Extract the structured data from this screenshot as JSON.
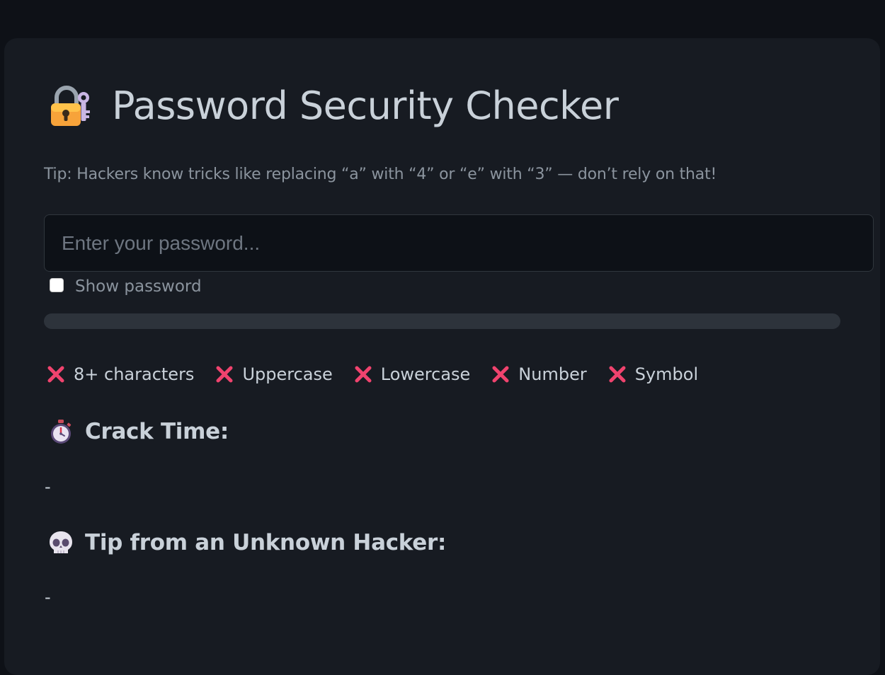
{
  "header": {
    "title": "Password Security Checker",
    "icon": "locked-with-key-icon"
  },
  "tip": "Tip: Hackers know tricks like replacing “a” with “4” or “e” with “3” — don’t rely on that!",
  "password_field": {
    "placeholder": "Enter your password...",
    "value": ""
  },
  "show_password": {
    "label": "Show password",
    "checked": false
  },
  "strength_meter": {
    "level": 0
  },
  "criteria": [
    {
      "label": "8+ characters",
      "met": false,
      "icon": "cross-mark-icon"
    },
    {
      "label": "Uppercase",
      "met": false,
      "icon": "cross-mark-icon"
    },
    {
      "label": "Lowercase",
      "met": false,
      "icon": "cross-mark-icon"
    },
    {
      "label": "Number",
      "met": false,
      "icon": "cross-mark-icon"
    },
    {
      "label": "Symbol",
      "met": false,
      "icon": "cross-mark-icon"
    }
  ],
  "crack_time": {
    "title": "Crack Time:",
    "icon": "stopwatch-icon",
    "value": "-"
  },
  "hacker_tip": {
    "title": "Tip from an Unknown Hacker:",
    "icon": "skull-icon",
    "value": "-"
  },
  "colors": {
    "page_bg": "#0e1117",
    "card_bg": "#171b22",
    "text": "#c9d1d9",
    "muted": "#8b949e",
    "meter_track": "#2d333b",
    "cross": "#f0436e"
  }
}
